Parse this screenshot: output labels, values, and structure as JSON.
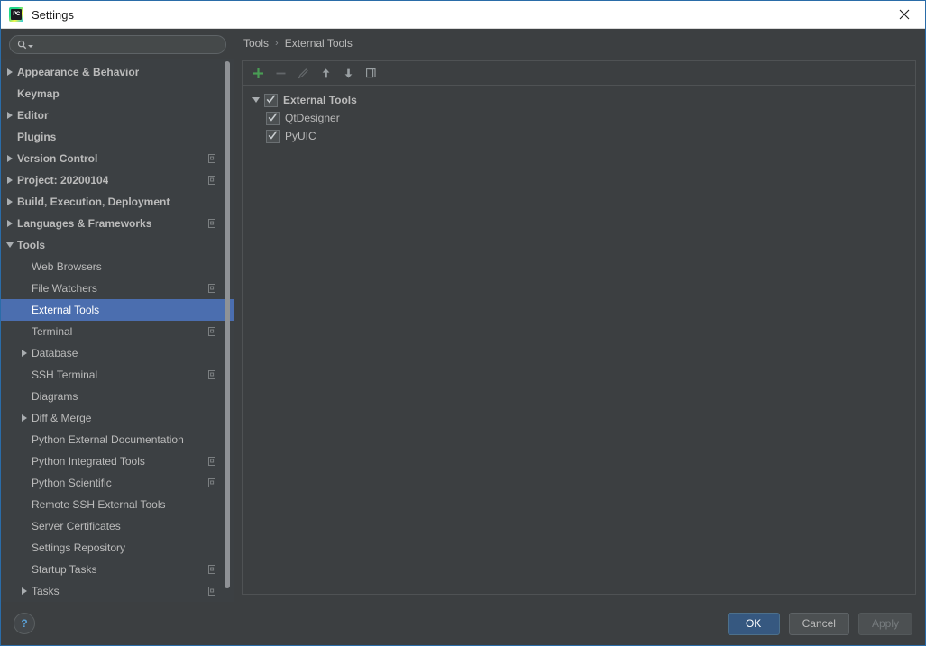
{
  "window": {
    "title": "Settings",
    "app_icon": "pycharm-logo-icon",
    "close_icon": "close-icon"
  },
  "search": {
    "value": "",
    "placeholder": "",
    "icon": "search-icon"
  },
  "sidebar": {
    "items": [
      {
        "label": "Appearance & Behavior",
        "arrow": "right",
        "indent": 0,
        "bold": true,
        "badge": false,
        "selected": false
      },
      {
        "label": "Keymap",
        "arrow": "none",
        "indent": 0,
        "bold": true,
        "badge": false,
        "selected": false
      },
      {
        "label": "Editor",
        "arrow": "right",
        "indent": 0,
        "bold": true,
        "badge": false,
        "selected": false
      },
      {
        "label": "Plugins",
        "arrow": "none",
        "indent": 0,
        "bold": true,
        "badge": false,
        "selected": false
      },
      {
        "label": "Version Control",
        "arrow": "right",
        "indent": 0,
        "bold": true,
        "badge": true,
        "selected": false
      },
      {
        "label": "Project: 20200104",
        "arrow": "right",
        "indent": 0,
        "bold": true,
        "badge": true,
        "selected": false
      },
      {
        "label": "Build, Execution, Deployment",
        "arrow": "right",
        "indent": 0,
        "bold": true,
        "badge": false,
        "selected": false
      },
      {
        "label": "Languages & Frameworks",
        "arrow": "right",
        "indent": 0,
        "bold": true,
        "badge": true,
        "selected": false
      },
      {
        "label": "Tools",
        "arrow": "down",
        "indent": 0,
        "bold": true,
        "badge": false,
        "selected": false
      },
      {
        "label": "Web Browsers",
        "arrow": "none",
        "indent": 1,
        "bold": false,
        "badge": false,
        "selected": false
      },
      {
        "label": "File Watchers",
        "arrow": "none",
        "indent": 1,
        "bold": false,
        "badge": true,
        "selected": false
      },
      {
        "label": "External Tools",
        "arrow": "none",
        "indent": 1,
        "bold": false,
        "badge": false,
        "selected": true
      },
      {
        "label": "Terminal",
        "arrow": "none",
        "indent": 1,
        "bold": false,
        "badge": true,
        "selected": false
      },
      {
        "label": "Database",
        "arrow": "right",
        "indent": 1,
        "bold": false,
        "badge": false,
        "selected": false
      },
      {
        "label": "SSH Terminal",
        "arrow": "none",
        "indent": 1,
        "bold": false,
        "badge": true,
        "selected": false
      },
      {
        "label": "Diagrams",
        "arrow": "none",
        "indent": 1,
        "bold": false,
        "badge": false,
        "selected": false
      },
      {
        "label": "Diff & Merge",
        "arrow": "right",
        "indent": 1,
        "bold": false,
        "badge": false,
        "selected": false
      },
      {
        "label": "Python External Documentation",
        "arrow": "none",
        "indent": 1,
        "bold": false,
        "badge": false,
        "selected": false
      },
      {
        "label": "Python Integrated Tools",
        "arrow": "none",
        "indent": 1,
        "bold": false,
        "badge": true,
        "selected": false
      },
      {
        "label": "Python Scientific",
        "arrow": "none",
        "indent": 1,
        "bold": false,
        "badge": true,
        "selected": false
      },
      {
        "label": "Remote SSH External Tools",
        "arrow": "none",
        "indent": 1,
        "bold": false,
        "badge": false,
        "selected": false
      },
      {
        "label": "Server Certificates",
        "arrow": "none",
        "indent": 1,
        "bold": false,
        "badge": false,
        "selected": false
      },
      {
        "label": "Settings Repository",
        "arrow": "none",
        "indent": 1,
        "bold": false,
        "badge": false,
        "selected": false
      },
      {
        "label": "Startup Tasks",
        "arrow": "none",
        "indent": 1,
        "bold": false,
        "badge": true,
        "selected": false
      },
      {
        "label": "Tasks",
        "arrow": "right",
        "indent": 1,
        "bold": false,
        "badge": true,
        "selected": false
      }
    ]
  },
  "breadcrumb": {
    "parent": "Tools",
    "separator": "›",
    "current": "External Tools"
  },
  "toolbar": {
    "buttons": [
      {
        "name": "add-button",
        "icon": "plus-icon",
        "enabled": true
      },
      {
        "name": "remove-button",
        "icon": "minus-icon",
        "enabled": false
      },
      {
        "name": "edit-button",
        "icon": "pencil-icon",
        "enabled": false
      },
      {
        "name": "move-up-button",
        "icon": "arrow-up-icon",
        "enabled": true
      },
      {
        "name": "move-down-button",
        "icon": "arrow-down-icon",
        "enabled": true
      },
      {
        "name": "copy-button",
        "icon": "copy-icon",
        "enabled": true
      }
    ]
  },
  "tools_tree": {
    "group": {
      "label": "External Tools",
      "checked": true,
      "expanded": true
    },
    "children": [
      {
        "label": "QtDesigner",
        "checked": true
      },
      {
        "label": "PyUIC",
        "checked": true
      }
    ]
  },
  "footer": {
    "help_label": "?",
    "ok_label": "OK",
    "cancel_label": "Cancel",
    "apply_label": "Apply"
  },
  "colors": {
    "accent_selection": "#4b6eaf",
    "default_button": "#365880",
    "panel_bg": "#3c3f41",
    "sidebar_bg": "#3c4043",
    "add_icon_green": "#499c54",
    "help_blue": "#5a9fd4"
  }
}
